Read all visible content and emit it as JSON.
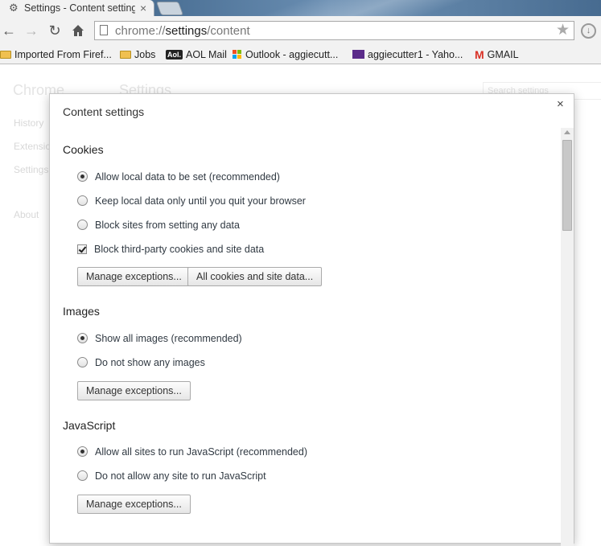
{
  "browser": {
    "tab_title": "Settings - Content settings",
    "tab_icon": "gear-icon",
    "url_scheme": "chrome://",
    "url_host": "settings",
    "url_path": "/content",
    "bookmarks": [
      {
        "label": "Imported From Firef...",
        "icon": "folder-icon"
      },
      {
        "label": "Jobs",
        "icon": "folder-icon"
      },
      {
        "label": "AOL Mail",
        "icon": "aol-icon"
      },
      {
        "label": "Outlook - aggiecutt...",
        "icon": "microsoft-icon"
      },
      {
        "label": "aggiecutter1 - Yaho...",
        "icon": "yahoo-mail-icon"
      },
      {
        "label": "GMAIL",
        "icon": "gmail-icon"
      }
    ]
  },
  "background_page": {
    "brand": "Chrome",
    "heading": "Settings",
    "nav": [
      "History",
      "Extensions",
      "Settings",
      "About"
    ],
    "search_placeholder": "Search settings"
  },
  "dialog": {
    "title": "Content settings",
    "close_label": "×",
    "cookies": {
      "heading": "Cookies",
      "options": [
        {
          "label": "Allow local data to be set (recommended)",
          "selected": true
        },
        {
          "label": "Keep local data only until you quit your browser",
          "selected": false
        },
        {
          "label": "Block sites from setting any data",
          "selected": false
        }
      ],
      "third_party": {
        "label": "Block third-party cookies and site data",
        "checked": true
      },
      "manage_label": "Manage exceptions...",
      "all_cookies_label": "All cookies and site data..."
    },
    "images": {
      "heading": "Images",
      "options": [
        {
          "label": "Show all images (recommended)",
          "selected": true
        },
        {
          "label": "Do not show any images",
          "selected": false
        }
      ],
      "manage_label": "Manage exceptions..."
    },
    "javascript": {
      "heading": "JavaScript",
      "options": [
        {
          "label": "Allow all sites to run JavaScript (recommended)",
          "selected": true
        },
        {
          "label": "Do not allow any site to run JavaScript",
          "selected": false
        }
      ],
      "manage_label": "Manage exceptions..."
    }
  }
}
